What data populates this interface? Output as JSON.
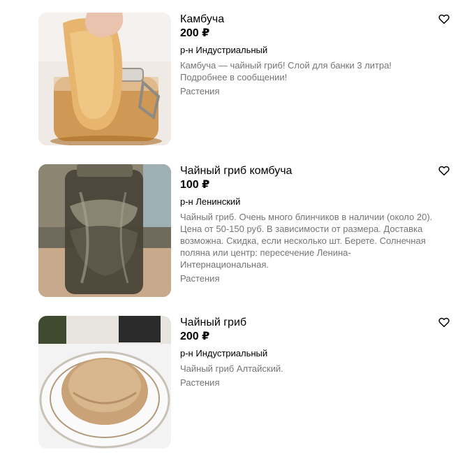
{
  "listings": [
    {
      "title": "Камбуча",
      "price": "200 ₽",
      "district": "р-н Индустриальный",
      "description": "Камбуча — чайный гриб! Слой для банки 3 литра! Подробнее в сообщении!",
      "category": "Растения",
      "favorite_icon": "heart-outline"
    },
    {
      "title": "Чайный гриб комбуча",
      "price": "100 ₽",
      "district": "р-н Ленинский",
      "description": "Чайный гриб. Очень много блинчиков в наличии (около 20). Цена от 50-150 руб. В зависимости от размера. Доставка возможна. Скидка, если несколько шт. Берете. Солнечная поляна или центр: пересечение Ленина-Интернациональная.",
      "category": "Растения",
      "favorite_icon": "heart-outline"
    },
    {
      "title": "Чайный гриб",
      "price": "200 ₽",
      "district": "р-н Индустриальный",
      "description": "Чайный гриб Алтайский.",
      "category": "Растения",
      "favorite_icon": "heart-outline"
    }
  ]
}
